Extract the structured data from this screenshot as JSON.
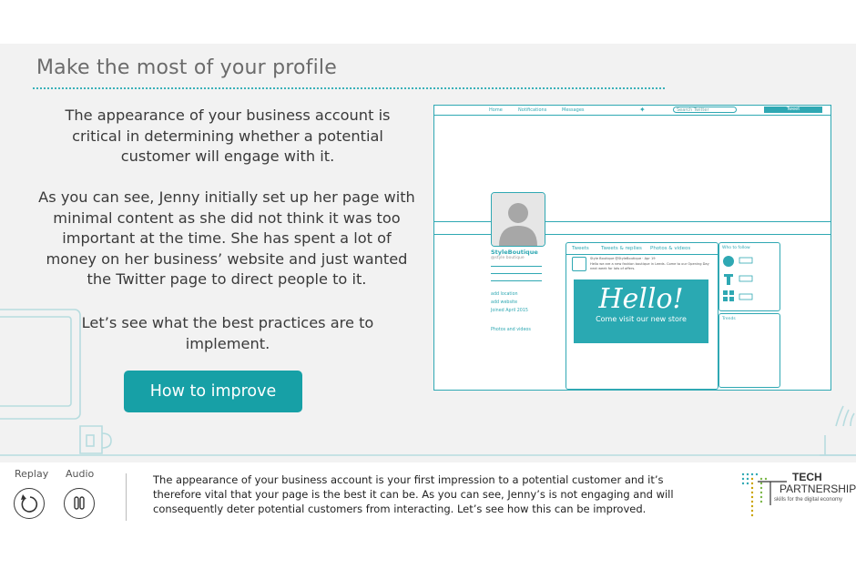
{
  "slide": {
    "title": "Make the most of your profile",
    "paragraph1": "The appearance of your business account is critical in determining whether a potential customer will engage with it.",
    "paragraph2": "As you can see, Jenny initially set up her page with minimal content as she did not think it was too important at the time. She has spent a lot of money on her business’ website and just wanted the Twitter page to direct people to it.",
    "paragraph3": "Let’s see what the best practices are to implement.",
    "improve_button": "How to improve"
  },
  "twitter_mock": {
    "nav": [
      "Home",
      "Notifications",
      "Messages"
    ],
    "search_placeholder": "Search Twitter",
    "tweet_button": "Tweet",
    "profile_name": "StyleBoutique",
    "profile_handle": "@style boutique",
    "location": "add location",
    "website": "add website",
    "joined": "Joined April 2015",
    "photos": "Photos and videos",
    "tabs": [
      "Tweets",
      "Tweets & replies",
      "Photos & videos"
    ],
    "tweet_author": "Style Boutique  @StyleBoutique · Apr 19",
    "tweet_text": "Hello we are a new fashion boutique in Leeds. Come to our Opening Day next week for lots of offers.",
    "hello_big": "Hello!",
    "hello_small": "Come visit our new store",
    "who_to_follow": "Who to follow",
    "trends": "Trends"
  },
  "footer": {
    "replay_label": "Replay",
    "audio_label": "Audio",
    "caption": "The appearance of your business account is your first impression to a potential customer and it’s therefore vital that your page is the best it can be. As you can see, Jenny’s is not engaging and will consequently deter potential customers from interacting. Let’s see how this can be improved."
  },
  "logo": {
    "line1": "TECH",
    "line2": "PARTNERSHIP",
    "tagline": "skills for the digital economy"
  },
  "colors": {
    "accent": "#17a0a6",
    "twitter_teal": "#2fa8b3",
    "slide_bg": "#f2f2f2",
    "title_gray": "#6b6b6b"
  }
}
